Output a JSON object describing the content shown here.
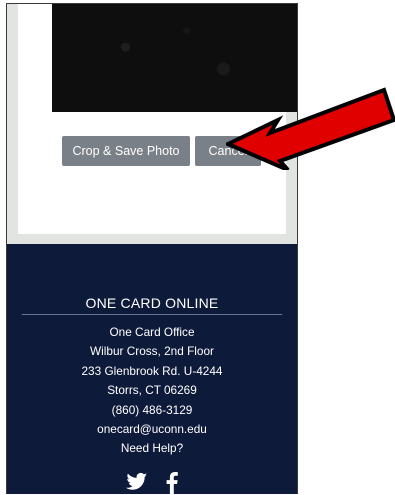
{
  "buttons": {
    "crop_save": "Crop & Save Photo",
    "cancel": "Cancel"
  },
  "footer": {
    "title": "ONE CARD ONLINE",
    "lines": [
      "One Card Office",
      "Wilbur Cross, 2nd Floor",
      "233 Glenbrook Rd. U-4244",
      "Storrs, CT 06269",
      "(860) 486-3129",
      "onecard@uconn.edu",
      "Need Help?"
    ],
    "social_icons": [
      "twitter-icon",
      "facebook-icon"
    ]
  },
  "colors": {
    "footer_bg": "#0e1a3a",
    "button_bg": "#7a8088",
    "arrow_fill": "#e00000"
  }
}
